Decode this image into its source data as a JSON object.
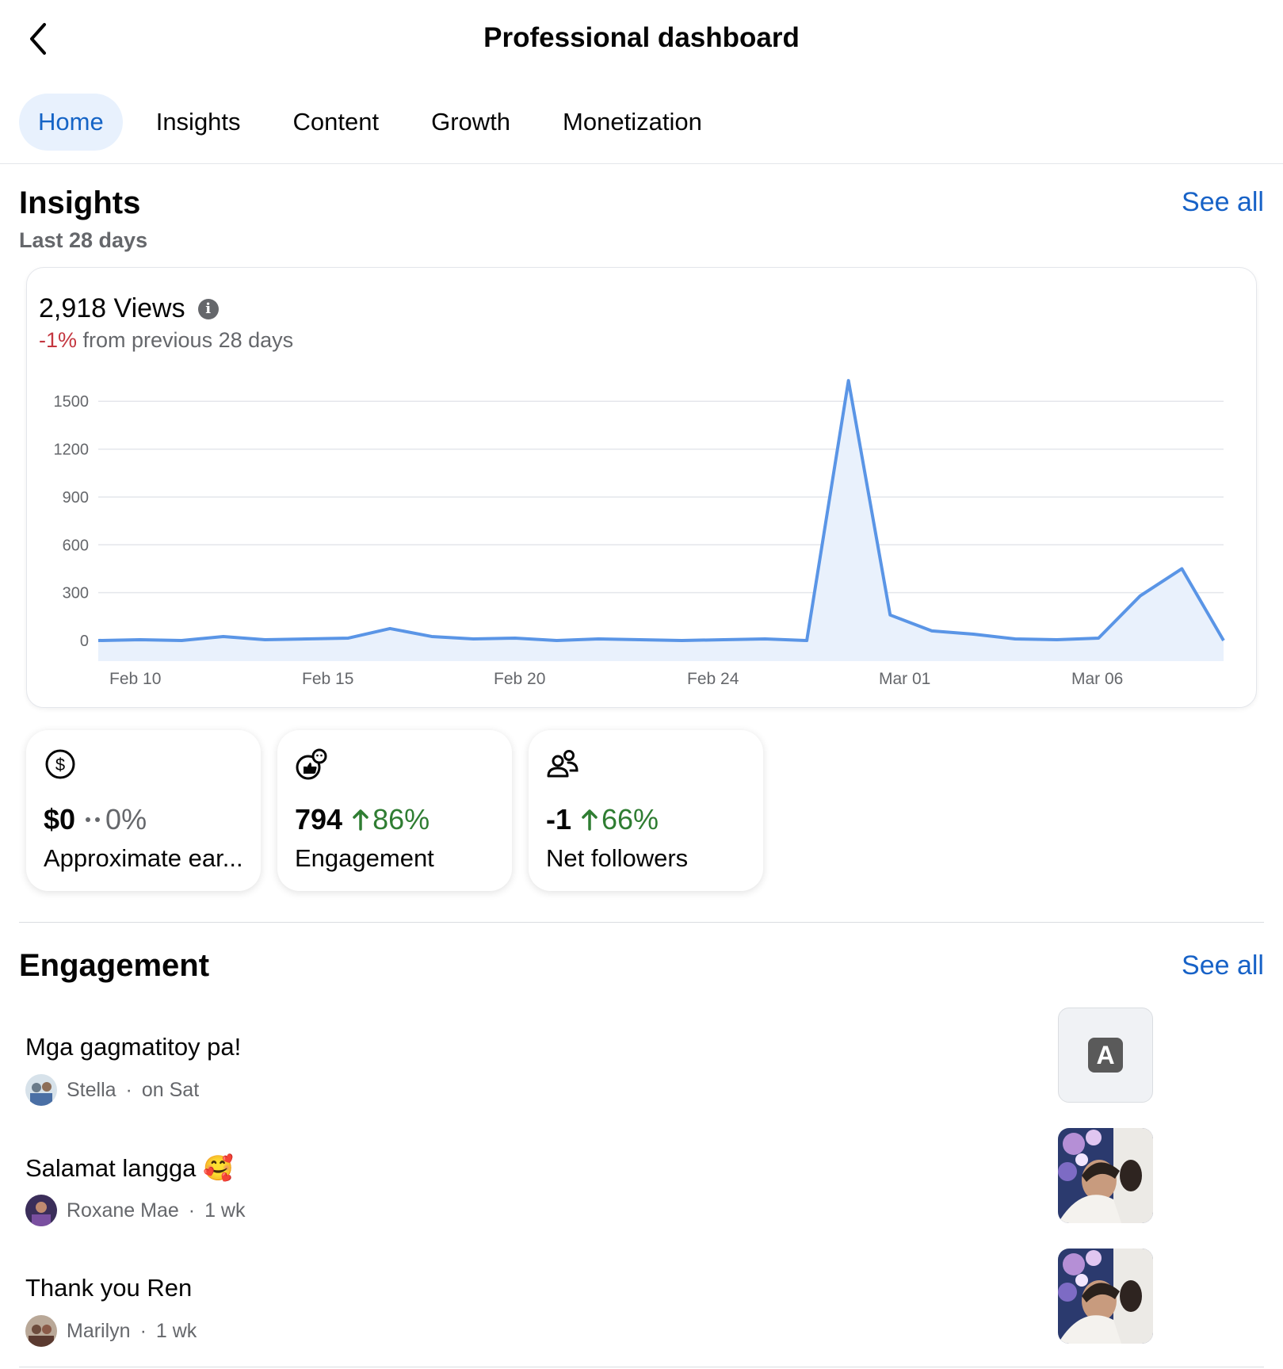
{
  "header": {
    "title": "Professional dashboard",
    "back_icon": "chevron-left-icon"
  },
  "tabs": [
    {
      "label": "Home",
      "active": true
    },
    {
      "label": "Insights",
      "active": false
    },
    {
      "label": "Content",
      "active": false
    },
    {
      "label": "Growth",
      "active": false
    },
    {
      "label": "Monetization",
      "active": false
    }
  ],
  "insights": {
    "title": "Insights",
    "see_all": "See all",
    "subtitle": "Last 28 days",
    "views": "2,918 Views",
    "delta": "-1%",
    "delta_suffix": " from previous 28 days"
  },
  "chart_data": {
    "type": "area",
    "x_tick_labels": [
      "Feb 10",
      "Feb 15",
      "Feb 20",
      "Feb 24",
      "Mar 01",
      "Mar 06"
    ],
    "y_ticks": [
      0,
      300,
      600,
      900,
      1200,
      1500
    ],
    "ylim": [
      0,
      1700
    ],
    "grid": true,
    "series": [
      {
        "color": "#5a95e6",
        "values": [
          0,
          5,
          0,
          25,
          5,
          10,
          15,
          75,
          25,
          10,
          15,
          0,
          10,
          5,
          0,
          5,
          10,
          0,
          1630,
          160,
          60,
          40,
          10,
          5,
          15,
          280,
          450,
          0
        ]
      }
    ]
  },
  "metrics": [
    {
      "icon": "dollar-circle-icon",
      "value": "$0",
      "change": "0%",
      "trend": "flat",
      "label": "Approximate ear..."
    },
    {
      "icon": "engagement-reactions-icon",
      "value": "794",
      "change": "86%",
      "trend": "up",
      "label": "Engagement"
    },
    {
      "icon": "people-icon",
      "value": "-1",
      "change": "66%",
      "trend": "up",
      "label": "Net followers"
    }
  ],
  "engagement": {
    "title": "Engagement",
    "see_all": "See all",
    "items": [
      {
        "text": "Mga gagmatitoy pa!",
        "author": "Stella",
        "time": "on Sat",
        "thumb": "text",
        "thumb_letter": "A"
      },
      {
        "text": "Salamat langga 🥰",
        "author": "Roxane Mae",
        "time": "1 wk",
        "thumb": "photo"
      },
      {
        "text": "Thank you Ren",
        "author": "Marilyn",
        "time": "1 wk",
        "thumb": "photo"
      }
    ]
  },
  "colors": {
    "accent": "#1762c7",
    "tab_active_bg": "#e8f1fd",
    "negative": "#c4363f",
    "positive": "#2f7d32",
    "chart_line": "#5a95e6",
    "chart_fill": "#e9f1fc"
  }
}
